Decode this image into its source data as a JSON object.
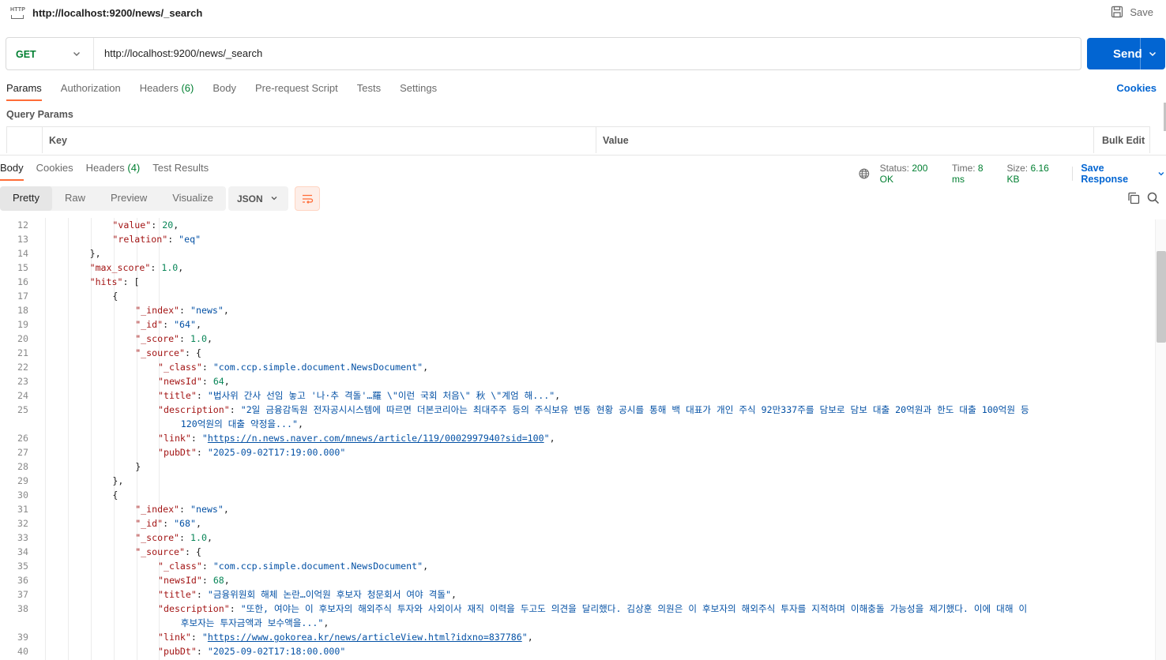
{
  "request": {
    "title": "http://localhost:9200/news/_search",
    "save_label": "Save",
    "method": "GET",
    "url": "http://localhost:9200/news/_search",
    "send_label": "Send"
  },
  "request_tabs": [
    {
      "label": "Params",
      "count": ""
    },
    {
      "label": "Authorization",
      "count": ""
    },
    {
      "label": "Headers",
      "count": "(6)"
    },
    {
      "label": "Body",
      "count": ""
    },
    {
      "label": "Pre-request Script",
      "count": ""
    },
    {
      "label": "Tests",
      "count": ""
    },
    {
      "label": "Settings",
      "count": ""
    }
  ],
  "cookies_label": "Cookies",
  "query_params": {
    "title": "Query Params",
    "col_key": "Key",
    "col_value": "Value",
    "bulk_edit": "Bulk Edit"
  },
  "response_tabs": [
    {
      "label": "Body",
      "count": ""
    },
    {
      "label": "Cookies",
      "count": ""
    },
    {
      "label": "Headers",
      "count": "(4)"
    },
    {
      "label": "Test Results",
      "count": ""
    }
  ],
  "status": {
    "status_label": "Status:",
    "status_value": "200 OK",
    "time_label": "Time:",
    "time_value": "8 ms",
    "size_label": "Size:",
    "size_value": "6.16 KB",
    "save_response": "Save Response"
  },
  "view_modes": [
    "Pretty",
    "Raw",
    "Preview",
    "Visualize"
  ],
  "format": "JSON",
  "colors": {
    "accent_orange": "#ff6c37",
    "send_blue": "#0265d2",
    "method_green": "#007f31"
  },
  "code_lines": [
    {
      "n": "12",
      "indent": 5,
      "parts": [
        [
          "k",
          "\"value\""
        ],
        [
          "p",
          ": "
        ],
        [
          "n",
          "20"
        ],
        [
          "p",
          ","
        ]
      ]
    },
    {
      "n": "13",
      "indent": 5,
      "parts": [
        [
          "k",
          "\"relation\""
        ],
        [
          "p",
          ": "
        ],
        [
          "s",
          "\"eq\""
        ]
      ]
    },
    {
      "n": "14",
      "indent": 4,
      "parts": [
        [
          "p",
          "},"
        ]
      ]
    },
    {
      "n": "15",
      "indent": 4,
      "parts": [
        [
          "k",
          "\"max_score\""
        ],
        [
          "p",
          ": "
        ],
        [
          "n",
          "1.0"
        ],
        [
          "p",
          ","
        ]
      ]
    },
    {
      "n": "16",
      "indent": 4,
      "parts": [
        [
          "k",
          "\"hits\""
        ],
        [
          "p",
          ": ["
        ]
      ]
    },
    {
      "n": "17",
      "indent": 5,
      "parts": [
        [
          "p",
          "{"
        ]
      ]
    },
    {
      "n": "18",
      "indent": 6,
      "parts": [
        [
          "k",
          "\"_index\""
        ],
        [
          "p",
          ": "
        ],
        [
          "s",
          "\"news\""
        ],
        [
          "p",
          ","
        ]
      ]
    },
    {
      "n": "19",
      "indent": 6,
      "parts": [
        [
          "k",
          "\"_id\""
        ],
        [
          "p",
          ": "
        ],
        [
          "s",
          "\"64\""
        ],
        [
          "p",
          ","
        ]
      ]
    },
    {
      "n": "20",
      "indent": 6,
      "parts": [
        [
          "k",
          "\"_score\""
        ],
        [
          "p",
          ": "
        ],
        [
          "n",
          "1.0"
        ],
        [
          "p",
          ","
        ]
      ]
    },
    {
      "n": "21",
      "indent": 6,
      "parts": [
        [
          "k",
          "\"_source\""
        ],
        [
          "p",
          ": {"
        ]
      ]
    },
    {
      "n": "22",
      "indent": 7,
      "parts": [
        [
          "k",
          "\"_class\""
        ],
        [
          "p",
          ": "
        ],
        [
          "s",
          "\"com.ccp.simple.document.NewsDocument\""
        ],
        [
          "p",
          ","
        ]
      ]
    },
    {
      "n": "23",
      "indent": 7,
      "parts": [
        [
          "k",
          "\"newsId\""
        ],
        [
          "p",
          ": "
        ],
        [
          "n",
          "64"
        ],
        [
          "p",
          ","
        ]
      ]
    },
    {
      "n": "24",
      "indent": 7,
      "parts": [
        [
          "k",
          "\"title\""
        ],
        [
          "p",
          ": "
        ],
        [
          "s",
          "\"법사위 간사 선임 놓고 '나·추 격돌'…羅 \\\"이런 국회 처음\\\" 秋 \\\"계엄 해...\""
        ],
        [
          "p",
          ","
        ]
      ]
    },
    {
      "n": "25",
      "indent": 7,
      "parts": [
        [
          "k",
          "\"description\""
        ],
        [
          "p",
          ": "
        ],
        [
          "s",
          "\"2일 금융감독원 전자공시시스템에 따르면 더본코리아는 최대주주 등의 주식보유 변동 현황 공시를 통해 백 대표가 개인 주식 92만337주를 담보로 담보 대출 20억원과 한도 대출 100억원 등"
        ]
      ]
    },
    {
      "n": "",
      "indent": 8,
      "parts": [
        [
          "s",
          "120억원의 대출 약정을...\""
        ],
        [
          "p",
          ","
        ]
      ]
    },
    {
      "n": "26",
      "indent": 7,
      "parts": [
        [
          "k",
          "\"link\""
        ],
        [
          "p",
          ": "
        ],
        [
          "s",
          "\""
        ],
        [
          "u",
          "https://n.news.naver.com/mnews/article/119/0002997940?sid=100"
        ],
        [
          "s",
          "\""
        ],
        [
          "p",
          ","
        ]
      ]
    },
    {
      "n": "27",
      "indent": 7,
      "parts": [
        [
          "k",
          "\"pubDt\""
        ],
        [
          "p",
          ": "
        ],
        [
          "s",
          "\"2025-09-02T17:19:00.000\""
        ]
      ]
    },
    {
      "n": "28",
      "indent": 6,
      "parts": [
        [
          "p",
          "}"
        ]
      ]
    },
    {
      "n": "29",
      "indent": 5,
      "parts": [
        [
          "p",
          "},"
        ]
      ]
    },
    {
      "n": "30",
      "indent": 5,
      "parts": [
        [
          "p",
          "{"
        ]
      ]
    },
    {
      "n": "31",
      "indent": 6,
      "parts": [
        [
          "k",
          "\"_index\""
        ],
        [
          "p",
          ": "
        ],
        [
          "s",
          "\"news\""
        ],
        [
          "p",
          ","
        ]
      ]
    },
    {
      "n": "32",
      "indent": 6,
      "parts": [
        [
          "k",
          "\"_id\""
        ],
        [
          "p",
          ": "
        ],
        [
          "s",
          "\"68\""
        ],
        [
          "p",
          ","
        ]
      ]
    },
    {
      "n": "33",
      "indent": 6,
      "parts": [
        [
          "k",
          "\"_score\""
        ],
        [
          "p",
          ": "
        ],
        [
          "n",
          "1.0"
        ],
        [
          "p",
          ","
        ]
      ]
    },
    {
      "n": "34",
      "indent": 6,
      "parts": [
        [
          "k",
          "\"_source\""
        ],
        [
          "p",
          ": {"
        ]
      ]
    },
    {
      "n": "35",
      "indent": 7,
      "parts": [
        [
          "k",
          "\"_class\""
        ],
        [
          "p",
          ": "
        ],
        [
          "s",
          "\"com.ccp.simple.document.NewsDocument\""
        ],
        [
          "p",
          ","
        ]
      ]
    },
    {
      "n": "36",
      "indent": 7,
      "parts": [
        [
          "k",
          "\"newsId\""
        ],
        [
          "p",
          ": "
        ],
        [
          "n",
          "68"
        ],
        [
          "p",
          ","
        ]
      ]
    },
    {
      "n": "37",
      "indent": 7,
      "parts": [
        [
          "k",
          "\"title\""
        ],
        [
          "p",
          ": "
        ],
        [
          "s",
          "\"금융위원회 해체 논란…이억원 후보자 청문회서 여야 격돌\""
        ],
        [
          "p",
          ","
        ]
      ]
    },
    {
      "n": "38",
      "indent": 7,
      "parts": [
        [
          "k",
          "\"description\""
        ],
        [
          "p",
          ": "
        ],
        [
          "s",
          "\"또한, 여야는 이 후보자의 해외주식 투자와 사외이사 재직 이력을 두고도 의견을 달리했다. 김상훈 의원은 이 후보자의 해외주식 투자를 지적하며 이해충돌 가능성을 제기했다. 이에 대해 이"
        ]
      ]
    },
    {
      "n": "",
      "indent": 8,
      "parts": [
        [
          "s",
          "후보자는 투자금액과 보수액을...\""
        ],
        [
          "p",
          ","
        ]
      ]
    },
    {
      "n": "39",
      "indent": 7,
      "parts": [
        [
          "k",
          "\"link\""
        ],
        [
          "p",
          ": "
        ],
        [
          "s",
          "\""
        ],
        [
          "u",
          "https://www.gokorea.kr/news/articleView.html?idxno=837786"
        ],
        [
          "s",
          "\""
        ],
        [
          "p",
          ","
        ]
      ]
    },
    {
      "n": "40",
      "indent": 7,
      "parts": [
        [
          "k",
          "\"pubDt\""
        ],
        [
          "p",
          ": "
        ],
        [
          "s",
          "\"2025-09-02T17:18:00.000\""
        ]
      ]
    }
  ]
}
